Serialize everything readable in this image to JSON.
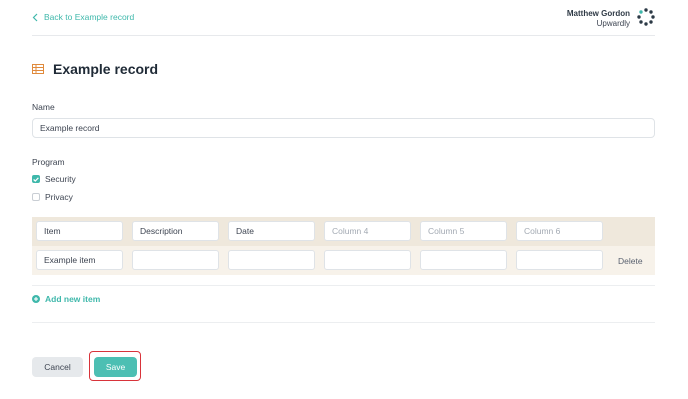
{
  "header": {
    "back_label": "Back to Example record",
    "user_name": "Matthew Gordon",
    "org_name": "Upwardly"
  },
  "page": {
    "title": "Example record",
    "title_icon": "table-icon"
  },
  "form": {
    "name_label": "Name",
    "name_value": "Example record",
    "program_label": "Program",
    "program_options": [
      {
        "label": "Security",
        "checked": true
      },
      {
        "label": "Privacy",
        "checked": false
      }
    ]
  },
  "table": {
    "headers": [
      "Item",
      "Description",
      "Date"
    ],
    "placeholders": [
      "Column 4",
      "Column 5",
      "Column 6"
    ],
    "rows": [
      {
        "cells": [
          "Example item",
          "",
          "",
          "",
          "",
          ""
        ],
        "delete_label": "Delete"
      }
    ],
    "add_label": "Add new item"
  },
  "actions": {
    "cancel_label": "Cancel",
    "save_label": "Save"
  },
  "colors": {
    "accent": "#3fb8ab",
    "table_header_bg": "#efe8dc",
    "title_icon": "#e08a3c",
    "highlight": "#d8333a"
  }
}
